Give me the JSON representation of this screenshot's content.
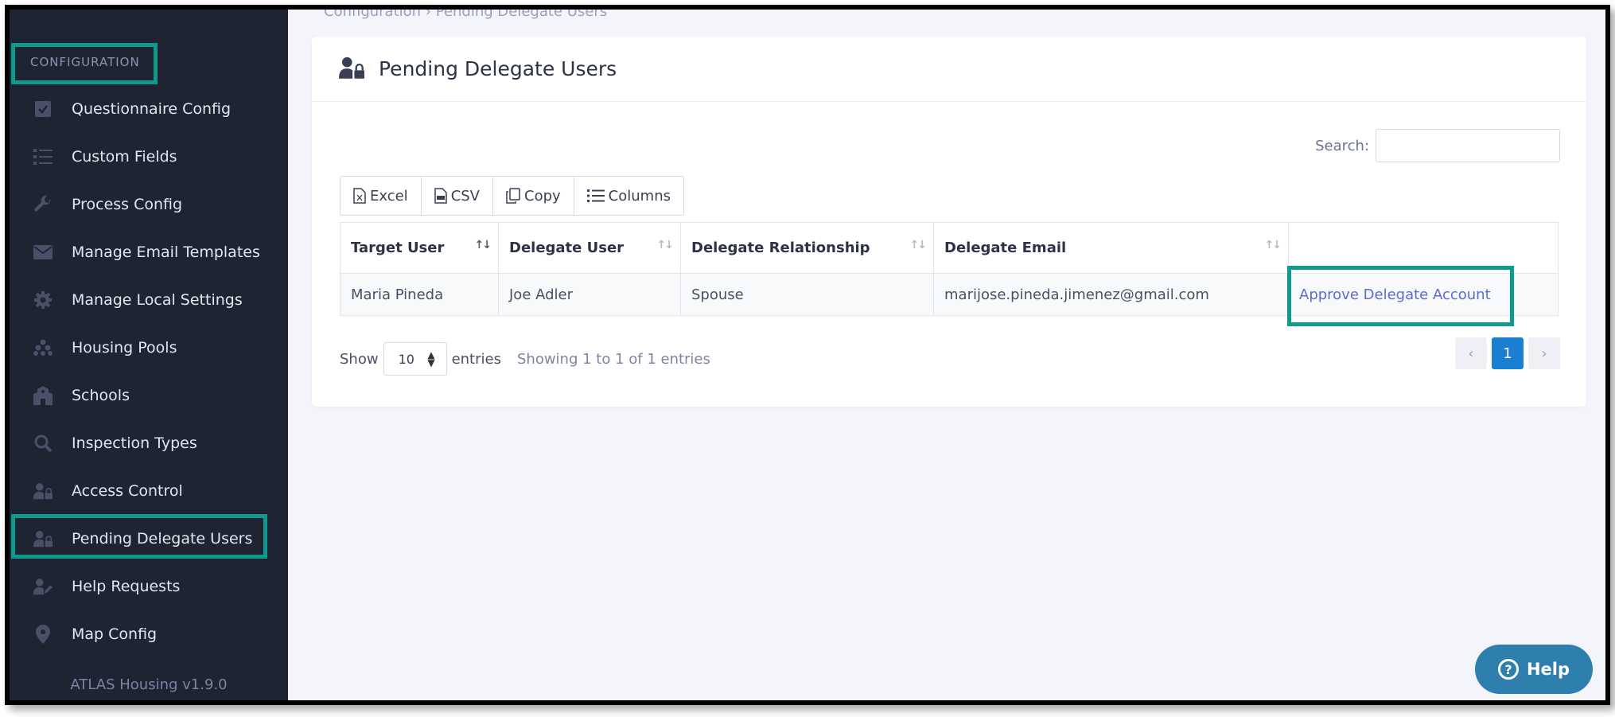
{
  "breadcrumb": "Configuration › Pending Delegate Users",
  "sidebar": {
    "section_title": "CONFIGURATION",
    "items": [
      {
        "label": "Questionnaire Config",
        "icon": "checkbox-icon"
      },
      {
        "label": "Custom Fields",
        "icon": "list-icon"
      },
      {
        "label": "Process Config",
        "icon": "wrench-icon"
      },
      {
        "label": "Manage Email Templates",
        "icon": "envelope-icon"
      },
      {
        "label": "Manage Local Settings",
        "icon": "gear-icon"
      },
      {
        "label": "Housing Pools",
        "icon": "cubes-icon"
      },
      {
        "label": "Schools",
        "icon": "school-icon"
      },
      {
        "label": "Inspection Types",
        "icon": "search-icon"
      },
      {
        "label": "Access Control",
        "icon": "user-lock-icon"
      },
      {
        "label": "Pending Delegate Users",
        "icon": "user-lock-icon",
        "active": true
      },
      {
        "label": "Help Requests",
        "icon": "user-edit-icon"
      },
      {
        "label": "Map Config",
        "icon": "map-pin-icon"
      }
    ],
    "version": "ATLAS Housing v1.9.0"
  },
  "card": {
    "title": "Pending Delegate Users",
    "search_label": "Search:",
    "search_value": "",
    "buttons": {
      "excel": "Excel",
      "csv": "CSV",
      "copy": "Copy",
      "columns": "Columns"
    },
    "table": {
      "headers": [
        "Target User",
        "Delegate User",
        "Delegate Relationship",
        "Delegate Email",
        ""
      ],
      "rows": [
        {
          "target_user": "Maria Pineda",
          "delegate_user": "Joe Adler",
          "relationship": "Spouse",
          "email": "marijose.pineda.jimenez@gmail.com",
          "action": "Approve Delegate Account"
        }
      ]
    },
    "show_label": "Show",
    "entries_value": "10",
    "entries_label": "entries",
    "info": "Showing 1 to 1 of 1 entries",
    "pager": {
      "prev": "‹",
      "current": "1",
      "next": "›"
    }
  },
  "help_button": "Help",
  "colors": {
    "sidebar_bg": "#1f2433",
    "highlight": "#0f9a8e",
    "link": "#5b6bd1",
    "pager_active": "#1b7fd1",
    "help_bg": "#2e7fad"
  }
}
